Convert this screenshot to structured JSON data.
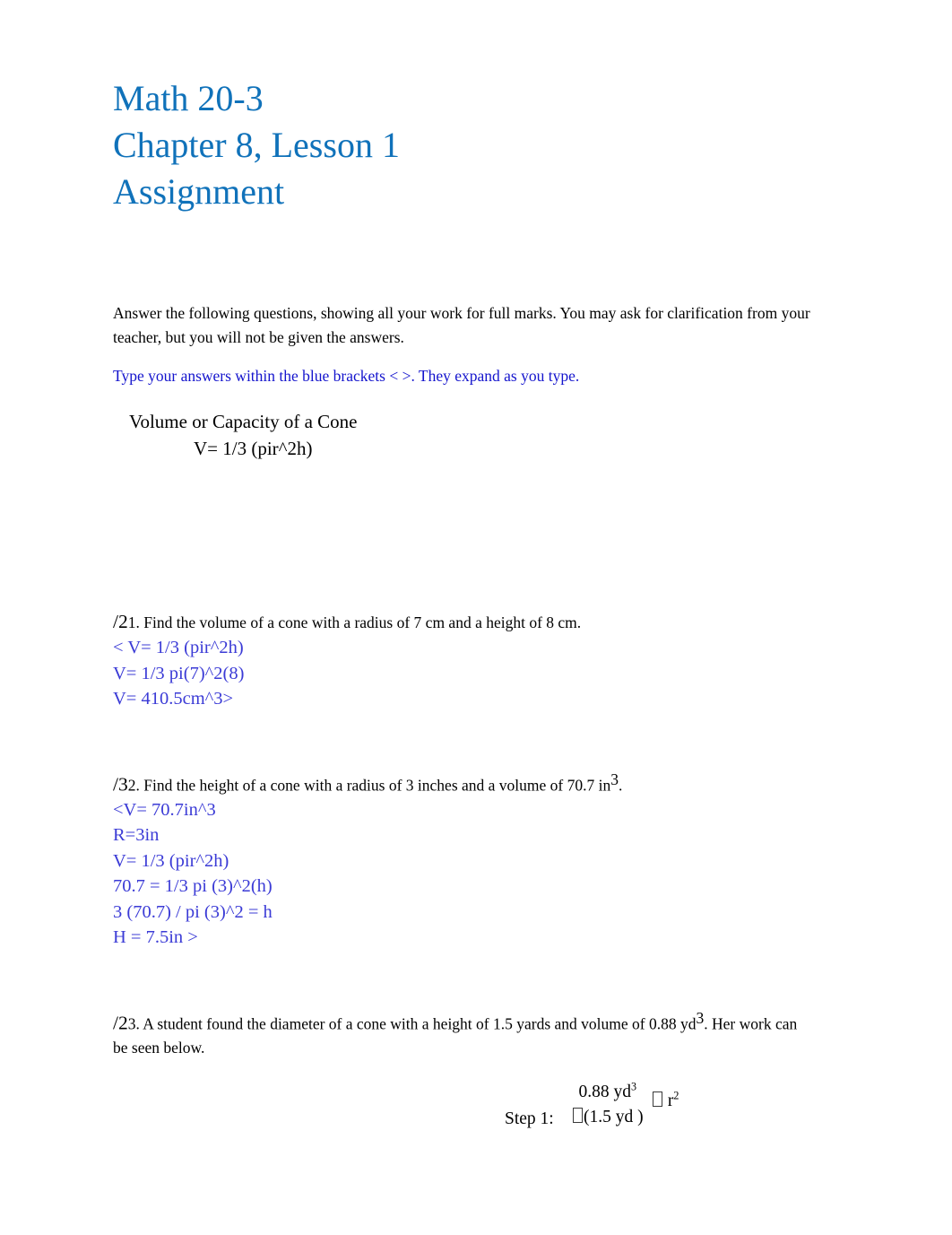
{
  "document": {
    "title_lines": [
      "Math 20-3",
      "Chapter 8, Lesson 1",
      "Assignment"
    ],
    "title_color": "#1072ba"
  },
  "intro": {
    "paragraph": "Answer the following questions, showing all your work for full marks.  You may ask for clarification from your teacher, but you will not be given the answers.",
    "note": "Type your answers within the blue brackets < >. They expand as you type.",
    "note_color": "#1414cd"
  },
  "formula": {
    "heading": "Volume or Capacity of a Cone",
    "expression": "V= 1/3 (pir^2h)"
  },
  "answer_color": "#3b3bd6",
  "questions": [
    {
      "marks": "/2",
      "number": "1.",
      "prompt_part1": " Find the volume of a cone with a radius of 7 cm and a height of 8 cm.",
      "answer_lines": [
        "< V= 1/3 (pir^2h)",
        "V= 1/3 pi(7)^2(8)",
        "V= 410.5cm^3>"
      ]
    },
    {
      "marks": "/3",
      "number": "2.",
      "prompt_part1": " Find the height  of a cone with a radius of 3 inches  and a volume of 70.7 in",
      "prompt_sup": "3",
      "prompt_part2": ".",
      "answer_lines": [
        "<V= 70.7in^3",
        "R=3in",
        "V= 1/3 (pir^2h)",
        "70.7 = 1/3 pi (3)^2(h)",
        "3 (70.7) / pi (3)^2 = h",
        "H = 7.5in >"
      ]
    },
    {
      "marks": "/2",
      "number": "3.",
      "prompt_part1": " A student found the diameter  of a cone with a height of 1.5 yards  and volume of 0.88 yd",
      "prompt_sup": "3",
      "prompt_part2": ".  Her work can be seen below.",
      "answer_lines": []
    }
  ],
  "step_equation": {
    "label": "Step 1:",
    "numerator_text": "0.88 yd",
    "numerator_sup": "3",
    "denominator_open": "(1.5 yd )",
    "tail_text": "r",
    "tail_sup": "2"
  }
}
